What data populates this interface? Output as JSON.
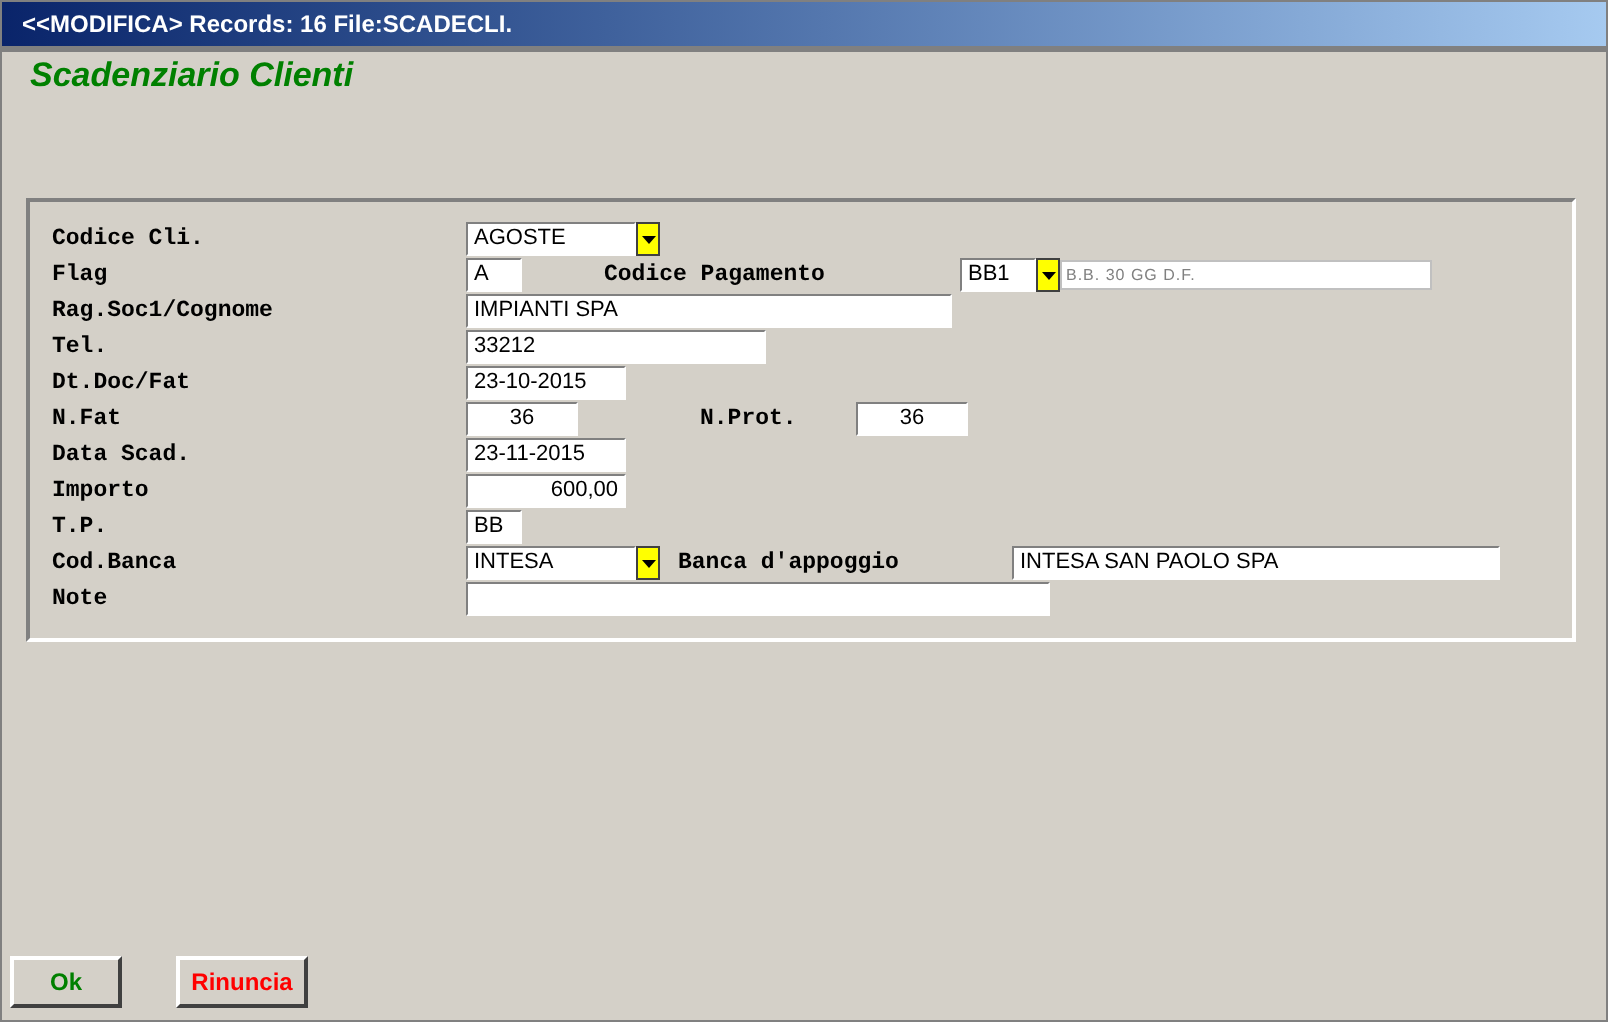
{
  "window": {
    "title": "<<MODIFICA> Records: 16  File:SCADECLI."
  },
  "heading": "Scadenziario Clienti",
  "fields": [
    {
      "label": "Codice Cli.",
      "value": "AGOSTE",
      "kind": "dropdown"
    },
    {
      "label": "Flag",
      "value": "A",
      "kind": "text",
      "extra": {
        "label": "Codice Pagamento",
        "value": "BB1",
        "kind": "dropdown",
        "description": "B.B. 30 GG D.F."
      }
    },
    {
      "label": "Rag.Soc1/Cognome",
      "value": "IMPIANTI SPA",
      "kind": "text"
    },
    {
      "label": "Tel.",
      "value": "33212",
      "kind": "text"
    },
    {
      "label": "Dt.Doc/Fat",
      "value": "23-10-2015",
      "kind": "text"
    },
    {
      "label": "N.Fat",
      "value": "36",
      "kind": "text",
      "extra": {
        "label": "N.Prot.",
        "value": "36",
        "kind": "text"
      }
    },
    {
      "label": "Data Scad.",
      "value": "23-11-2015",
      "kind": "text"
    },
    {
      "label": "Importo",
      "value": "600,00",
      "kind": "text"
    },
    {
      "label": "T.P.",
      "value": "BB",
      "kind": "text"
    },
    {
      "label": "Cod.Banca",
      "value": "INTESA",
      "kind": "dropdown",
      "extra": {
        "label": "Banca d'appoggio",
        "value": "INTESA SAN PAOLO SPA",
        "kind": "text"
      }
    },
    {
      "label": "Note",
      "kind": "text"
    }
  ],
  "buttons": [
    {
      "label": "Ok",
      "kind": "confirm"
    },
    {
      "label": "Rinuncia",
      "kind": "cancel"
    }
  ]
}
